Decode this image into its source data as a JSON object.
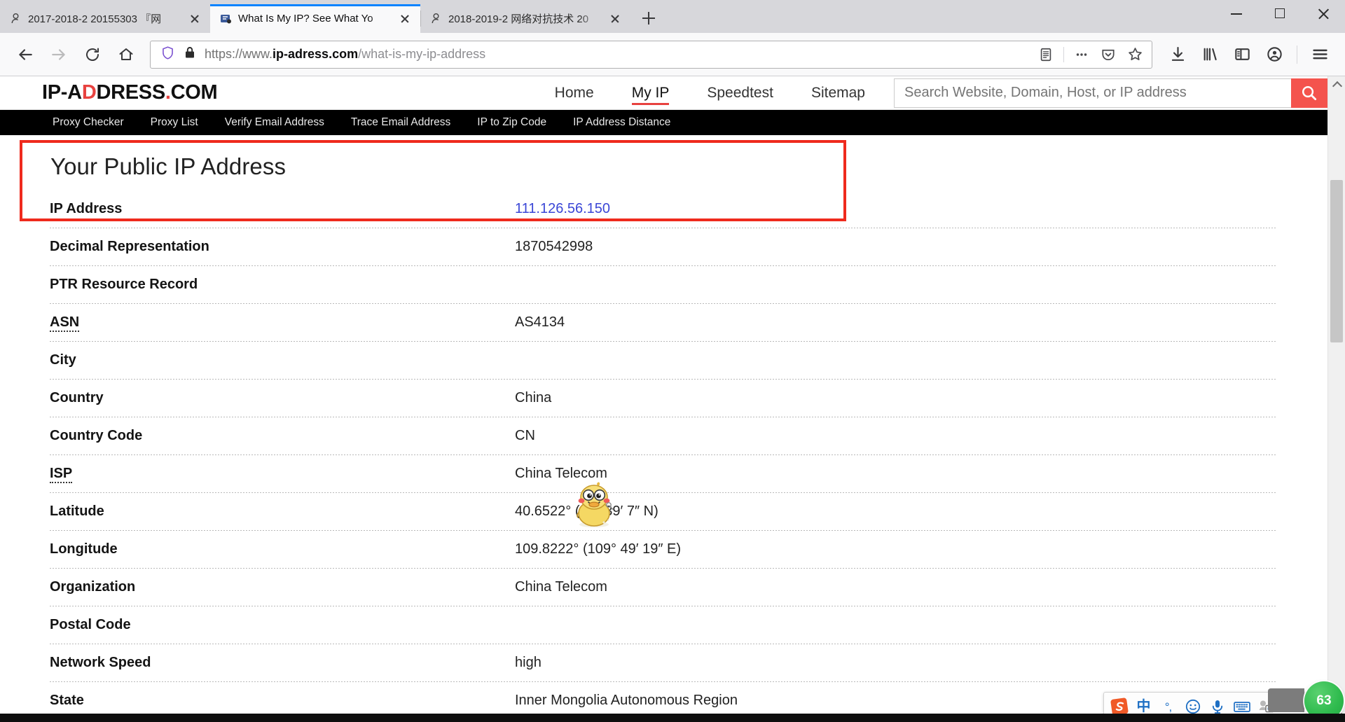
{
  "browser": {
    "tabs": [
      {
        "title": "2017-2018-2 20155303 『网",
        "favicon": "person-icon",
        "active": false
      },
      {
        "title": "What Is My IP? See What Yo",
        "favicon": "site-icon",
        "active": true
      },
      {
        "title": "2018-2019-2 网络对抗技术 20",
        "favicon": "person-icon",
        "active": false
      }
    ],
    "newtab_label": "+",
    "window_controls": {
      "minimize": "minimize-icon",
      "maximize": "maximize-icon",
      "close": "close-icon"
    },
    "toolbar": {
      "back": "back-icon",
      "forward": "forward-icon",
      "reload": "reload-icon",
      "home": "home-icon",
      "downloads": "downloads-icon",
      "library": "library-icon",
      "sidebar": "sidebar-icon",
      "account": "account-icon",
      "menu": "hamburger-menu-icon"
    },
    "urlbar": {
      "scheme": "https://www.",
      "domain": "ip-adress.com",
      "path": "/what-is-my-ip-address",
      "full_url": "https://www.ip-adress.com/what-is-my-ip-address",
      "shield_icon": "tracking-protection-shield-icon",
      "lock_icon": "padlock-icon",
      "reader_icon": "reader-view-icon",
      "page_actions_icon": "ellipsis-icon",
      "pocket_icon": "pocket-icon",
      "bookmark_icon": "star-icon"
    }
  },
  "site": {
    "logo": {
      "pre": "IP-A",
      "accent": "D",
      "post": "DRESS",
      "dot": ".",
      "tld": "COM"
    },
    "nav": [
      {
        "label": "Home",
        "active": false
      },
      {
        "label": "My IP",
        "active": true
      },
      {
        "label": "Speedtest",
        "active": false
      },
      {
        "label": "Sitemap",
        "active": false
      }
    ],
    "search": {
      "placeholder": "Search Website, Domain, Host, or IP address",
      "value": "",
      "button_icon": "search-icon",
      "button_color": "#f4534d"
    },
    "subnav": [
      "Proxy Checker",
      "Proxy List",
      "Verify Email Address",
      "Trace Email Address",
      "IP to Zip Code",
      "IP Address Distance"
    ]
  },
  "main": {
    "heading": "Your Public IP Address",
    "highlight_color": "#ef2a1d",
    "rows": [
      {
        "key": "IP Address",
        "value": "111.126.56.150",
        "link": true,
        "abbr": false
      },
      {
        "key": "Decimal Representation",
        "value": "1870542998",
        "link": false,
        "abbr": false
      },
      {
        "key": "PTR Resource Record",
        "value": "",
        "link": false,
        "abbr": false
      },
      {
        "key": "ASN",
        "value": "AS4134",
        "link": false,
        "abbr": true
      },
      {
        "key": "City",
        "value": "",
        "link": false,
        "abbr": false
      },
      {
        "key": "Country",
        "value": "China",
        "link": false,
        "abbr": false
      },
      {
        "key": "Country Code",
        "value": "CN",
        "link": false,
        "abbr": false
      },
      {
        "key": "ISP",
        "value": "China Telecom",
        "link": false,
        "abbr": true
      },
      {
        "key": "Latitude",
        "value": "40.6522° (40° 39′ 7″ N)",
        "link": false,
        "abbr": false
      },
      {
        "key": "Longitude",
        "value": "109.8222° (109° 49′ 19″ E)",
        "link": false,
        "abbr": false
      },
      {
        "key": "Organization",
        "value": "China Telecom",
        "link": false,
        "abbr": false
      },
      {
        "key": "Postal Code",
        "value": "",
        "link": false,
        "abbr": false
      },
      {
        "key": "Network Speed",
        "value": "high",
        "link": false,
        "abbr": false
      },
      {
        "key": "State",
        "value": "Inner Mongolia Autonomous Region",
        "link": false,
        "abbr": false
      }
    ],
    "sticker": "duck-sticker"
  },
  "ime": {
    "name": "sogou-ime-toolbar",
    "items": [
      {
        "name": "sogou-logo-icon",
        "label": "S"
      },
      {
        "name": "chinese-mode-icon",
        "label": "中"
      },
      {
        "name": "punctuation-mode-icon",
        "label": "°,"
      },
      {
        "name": "emoji-icon",
        "label": ""
      },
      {
        "name": "voice-input-icon",
        "label": ""
      },
      {
        "name": "soft-keyboard-icon",
        "label": ""
      },
      {
        "name": "translate-icon",
        "label": ""
      },
      {
        "name": "skin-icon",
        "label": ""
      },
      {
        "name": "apps-icon",
        "label": ""
      }
    ]
  },
  "widget": {
    "name": "system-monitor-widget",
    "value": "63"
  },
  "scrollbar": {
    "up_icon": "chevron-up-icon",
    "down_icon": "chevron-down-icon"
  }
}
